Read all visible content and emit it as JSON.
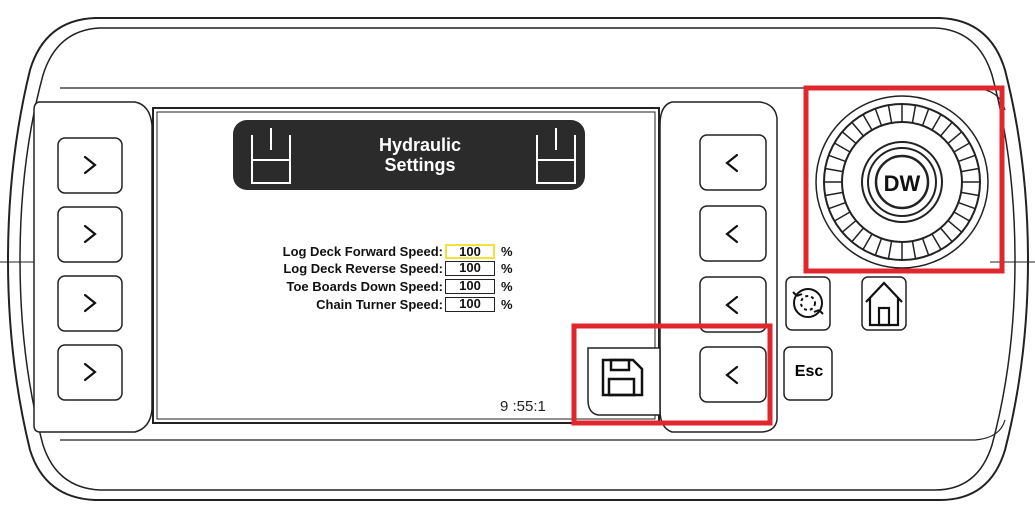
{
  "screen": {
    "title_line1": "Hydraulic",
    "title_line2": "Settings",
    "clock": "9 :55:1",
    "rows": [
      {
        "label": "Log Deck Forward Speed:",
        "value": "100",
        "unit": "%",
        "selected": true
      },
      {
        "label": "Log Deck Reverse Speed:",
        "value": "100",
        "unit": "%",
        "selected": false
      },
      {
        "label": "Toe Boards Down Speed:",
        "value": "100",
        "unit": "%",
        "selected": false
      },
      {
        "label": "Chain Turner Speed:",
        "value": "100",
        "unit": "%",
        "selected": false
      }
    ]
  },
  "buttons": {
    "esc_label": "Esc",
    "left_icon": "chevron-right-icon",
    "right_icon": "chevron-left-icon",
    "save_icon": "floppy-disk-icon",
    "refresh_icon": "refresh-cycle-icon",
    "home_icon": "home-icon"
  },
  "knob": {
    "logo": "DW"
  },
  "highlight_color": "#e0272e",
  "selection_color": "#f2e23a"
}
